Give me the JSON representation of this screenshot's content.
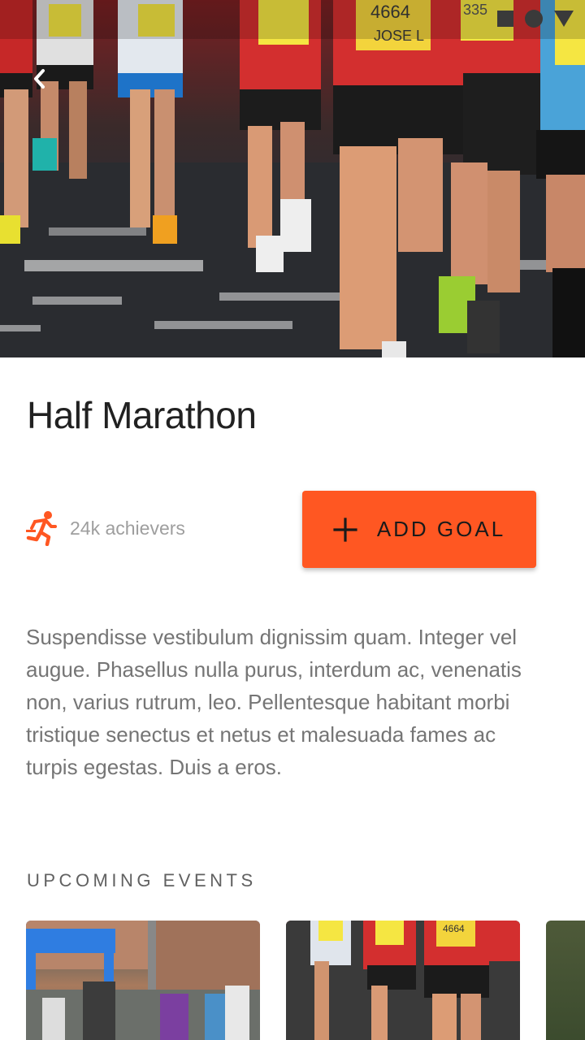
{
  "hero": {
    "bib_numbers": [
      "4664",
      "335"
    ],
    "bib_name": "JOSE L"
  },
  "title": "Half Marathon",
  "achievers": {
    "text": "24k achievers"
  },
  "add_goal": {
    "label": "ADD GOAL"
  },
  "description": "Suspendisse vestibulum dignissim quam. Integer vel augue. Phasellus nulla purus, interdum ac, venenatis non, varius rutrum, leo. Pellentesque habitant morbi tristique senectus et netus et malesuada fames ac turpis egestas. Duis a eros.",
  "upcoming": {
    "title": "UPCOMING EVENTS",
    "cards": [
      {
        "bib": ""
      },
      {
        "bib": "4664"
      },
      {
        "bib": ""
      }
    ]
  },
  "colors": {
    "accent": "#ff5722",
    "title": "#212121",
    "muted": "#9e9e9e",
    "body": "#757575"
  }
}
